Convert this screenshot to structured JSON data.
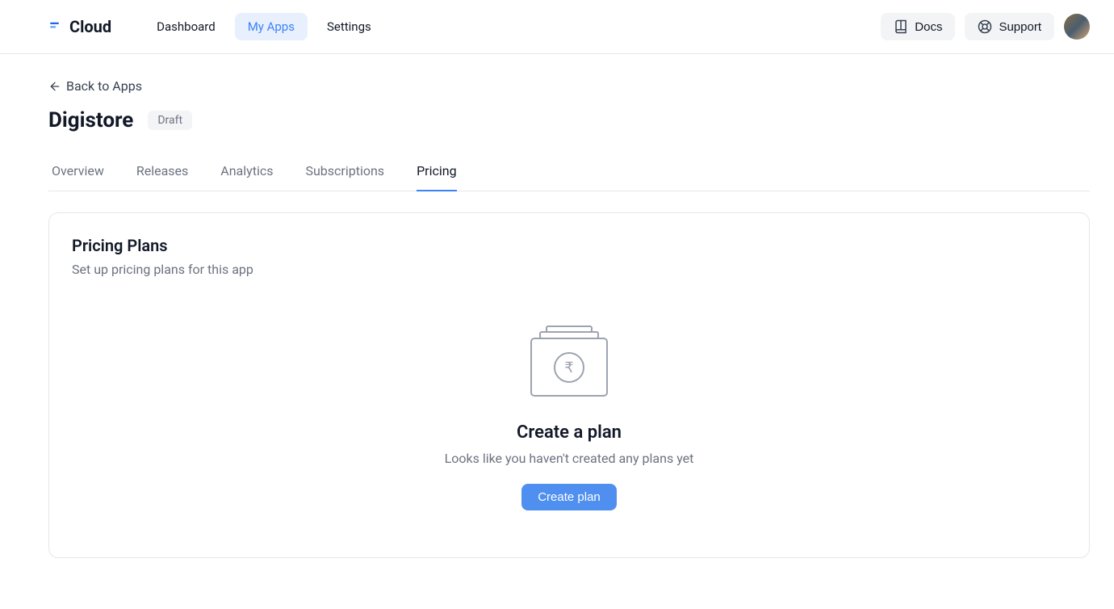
{
  "brand": {
    "name": "Cloud"
  },
  "nav": {
    "items": [
      {
        "label": "Dashboard",
        "active": false
      },
      {
        "label": "My Apps",
        "active": true
      },
      {
        "label": "Settings",
        "active": false
      }
    ]
  },
  "header_actions": {
    "docs_label": "Docs",
    "support_label": "Support"
  },
  "back_link": {
    "label": "Back to Apps"
  },
  "app": {
    "name": "Digistore",
    "status": "Draft"
  },
  "tabs": {
    "items": [
      {
        "label": "Overview",
        "active": false
      },
      {
        "label": "Releases",
        "active": false
      },
      {
        "label": "Analytics",
        "active": false
      },
      {
        "label": "Subscriptions",
        "active": false
      },
      {
        "label": "Pricing",
        "active": true
      }
    ]
  },
  "card": {
    "title": "Pricing Plans",
    "subtitle": "Set up pricing plans for this app"
  },
  "empty": {
    "title": "Create a plan",
    "text": "Looks like you haven't created any plans yet",
    "button": "Create plan"
  }
}
